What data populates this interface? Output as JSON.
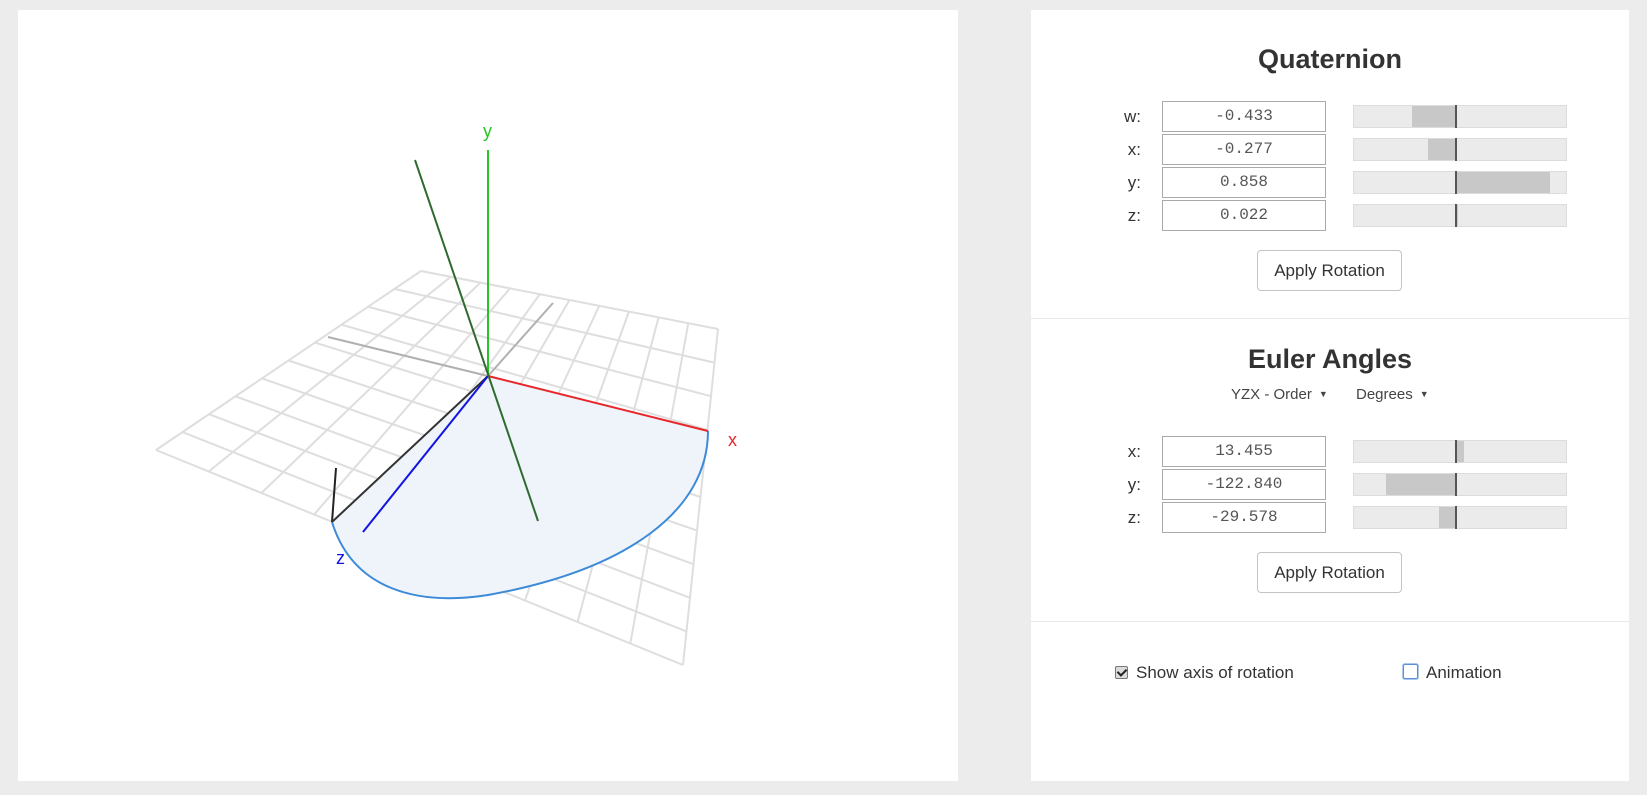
{
  "viewport": {
    "axis_labels": {
      "x": "x",
      "y": "y",
      "z": "z"
    },
    "colors": {
      "x_axis": "#e8262a",
      "y_axis": "#27c427",
      "z_axis": "#1414e0",
      "rotation_axis": "#2e6b2e",
      "grid": "#dedede",
      "arc": "#3c8ad8",
      "arc_fill": "#eef4fa"
    }
  },
  "quaternion": {
    "title": "Quaternion",
    "rows": [
      {
        "label": "w:",
        "value": "-0.433",
        "fraction": -0.433
      },
      {
        "label": "x:",
        "value": "-0.277",
        "fraction": -0.277
      },
      {
        "label": "y:",
        "value": "0.858",
        "fraction": 0.858
      },
      {
        "label": "z:",
        "value": "0.022",
        "fraction": 0.022
      }
    ],
    "apply_label": "Apply Rotation"
  },
  "euler": {
    "title": "Euler Angles",
    "order_label": "YZX - Order",
    "unit_label": "Degrees",
    "rows": [
      {
        "label": "x:",
        "value": "13.455",
        "fraction": 0.0748
      },
      {
        "label": "y:",
        "value": "-122.840",
        "fraction": -0.6824
      },
      {
        "label": "z:",
        "value": "-29.578",
        "fraction": -0.1643
      }
    ],
    "apply_label": "Apply Rotation"
  },
  "options": {
    "show_axis_label": "Show axis of rotation",
    "show_axis_checked": true,
    "animation_label": "Animation",
    "animation_checked": false
  }
}
